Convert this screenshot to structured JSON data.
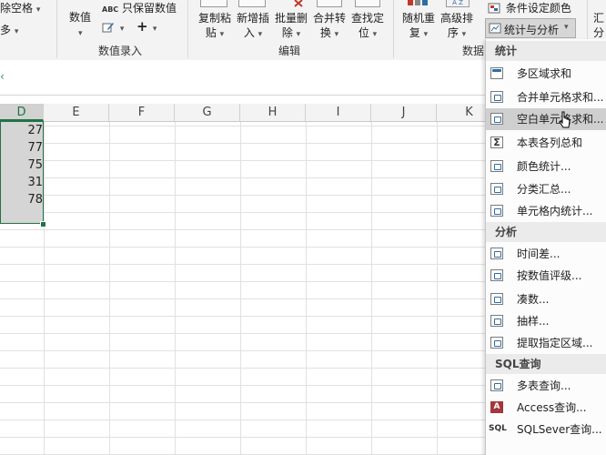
{
  "ribbon": {
    "remove_spaces": "除空格",
    "more": "多",
    "values": "数值",
    "keep_values": "只保留数值",
    "group_data_entry": "数值录入",
    "copy_paste": [
      "复制粘",
      "贴"
    ],
    "insert_new": [
      "新增插",
      "入"
    ],
    "batch_delete": [
      "批量删",
      "除"
    ],
    "merge_convert": [
      "合并转",
      "换"
    ],
    "find_locate": [
      "查找定",
      "位"
    ],
    "group_edit": "编辑",
    "random_repeat": [
      "随机重",
      "复"
    ],
    "advanced_sort": [
      "高级排",
      "序"
    ],
    "conditional_color": "条件设定颜色",
    "stats_analysis": "统计与分析",
    "group_data": "数据",
    "summary_partial": [
      "汇",
      "分"
    ]
  },
  "grid": {
    "columns": [
      "D",
      "E",
      "F",
      "G",
      "H",
      "I",
      "J",
      "K"
    ],
    "selected_column": "D",
    "cells": [
      "27",
      "77",
      "75",
      "31",
      "78"
    ]
  },
  "menu": {
    "sections": [
      {
        "title": "统计",
        "items": [
          {
            "label": "多区域求和",
            "icon": "table-icon"
          },
          {
            "label": "合并单元格求和...",
            "icon": "calc-icon"
          },
          {
            "label": "空白单元格求和...",
            "icon": "calc-icon",
            "highlighted": true
          },
          {
            "label": "本表各列总和",
            "icon": "sigma-icon"
          },
          {
            "label": "颜色统计...",
            "icon": "calc-icon"
          },
          {
            "label": "分类汇总...",
            "icon": "calc-icon"
          },
          {
            "label": "单元格内统计...",
            "icon": "calc-icon"
          }
        ]
      },
      {
        "title": "分析",
        "items": [
          {
            "label": "时间差...",
            "icon": "calc-icon"
          },
          {
            "label": "按数值评级...",
            "icon": "calc-icon"
          },
          {
            "label": "凑数...",
            "icon": "calc-icon"
          },
          {
            "label": "抽样...",
            "icon": "calc-icon"
          },
          {
            "label": "提取指定区域...",
            "icon": "calc-icon"
          }
        ]
      },
      {
        "title": "SQL查询",
        "items": [
          {
            "label": "多表查询...",
            "icon": "multi-table-query-icon"
          },
          {
            "label": "Access查询...",
            "icon": "access-icon"
          },
          {
            "label": "SQLSever查询...",
            "icon": "sql-icon"
          }
        ]
      }
    ]
  },
  "colors": {
    "accent_green": "#217346",
    "selection_fill": "#d5d5d5",
    "menu_highlight": "#cfcfcf"
  }
}
